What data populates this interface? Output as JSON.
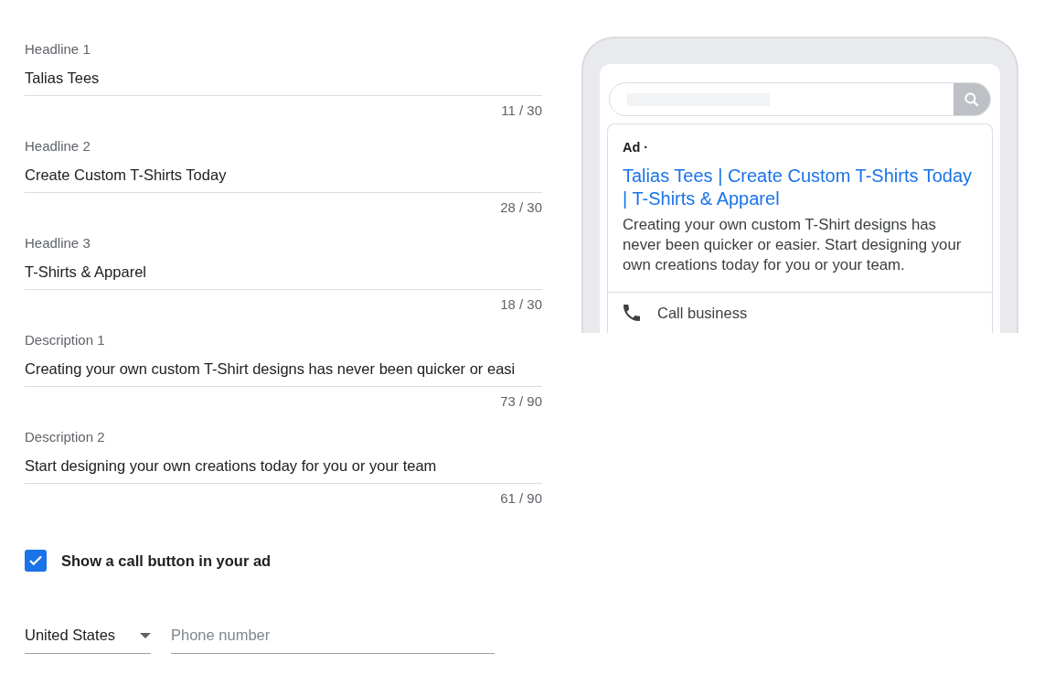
{
  "fields": [
    {
      "label": "Headline 1",
      "value": "Talias Tees",
      "counter": "11 / 30"
    },
    {
      "label": "Headline 2",
      "value": "Create Custom T-Shirts Today",
      "counter": "28 / 30"
    },
    {
      "label": "Headline 3",
      "value": "T-Shirts & Apparel",
      "counter": "18 / 30"
    },
    {
      "label": "Description 1",
      "value": "Creating your own custom T-Shirt designs has never been quicker or easi",
      "counter": "73 / 90"
    },
    {
      "label": "Description 2",
      "value": "Start designing your own creations today for you or your team",
      "counter": "61 / 90"
    }
  ],
  "call_button": {
    "label": "Show a call button in your ad",
    "checked": true
  },
  "country": {
    "value": "United States"
  },
  "phone": {
    "placeholder": "Phone number"
  },
  "preview": {
    "ad_label": "Ad ·",
    "headline": "Talias Tees | Create Custom T-Shirts Today | T-Shirts & Apparel",
    "description": "Creating your own custom T-Shirt designs has never been quicker or easier. Start designing your own creations today for you or your team.",
    "call_label": "Call business"
  }
}
